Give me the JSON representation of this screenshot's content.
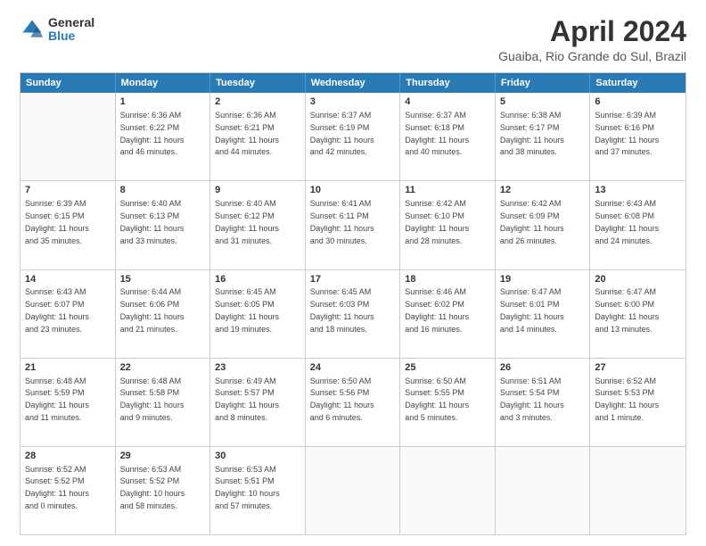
{
  "logo": {
    "general": "General",
    "blue": "Blue"
  },
  "title": "April 2024",
  "location": "Guaiba, Rio Grande do Sul, Brazil",
  "header_days": [
    "Sunday",
    "Monday",
    "Tuesday",
    "Wednesday",
    "Thursday",
    "Friday",
    "Saturday"
  ],
  "weeks": [
    [
      {
        "day": "",
        "text": ""
      },
      {
        "day": "1",
        "text": "Sunrise: 6:36 AM\nSunset: 6:22 PM\nDaylight: 11 hours\nand 46 minutes."
      },
      {
        "day": "2",
        "text": "Sunrise: 6:36 AM\nSunset: 6:21 PM\nDaylight: 11 hours\nand 44 minutes."
      },
      {
        "day": "3",
        "text": "Sunrise: 6:37 AM\nSunset: 6:19 PM\nDaylight: 11 hours\nand 42 minutes."
      },
      {
        "day": "4",
        "text": "Sunrise: 6:37 AM\nSunset: 6:18 PM\nDaylight: 11 hours\nand 40 minutes."
      },
      {
        "day": "5",
        "text": "Sunrise: 6:38 AM\nSunset: 6:17 PM\nDaylight: 11 hours\nand 38 minutes."
      },
      {
        "day": "6",
        "text": "Sunrise: 6:39 AM\nSunset: 6:16 PM\nDaylight: 11 hours\nand 37 minutes."
      }
    ],
    [
      {
        "day": "7",
        "text": "Sunrise: 6:39 AM\nSunset: 6:15 PM\nDaylight: 11 hours\nand 35 minutes."
      },
      {
        "day": "8",
        "text": "Sunrise: 6:40 AM\nSunset: 6:13 PM\nDaylight: 11 hours\nand 33 minutes."
      },
      {
        "day": "9",
        "text": "Sunrise: 6:40 AM\nSunset: 6:12 PM\nDaylight: 11 hours\nand 31 minutes."
      },
      {
        "day": "10",
        "text": "Sunrise: 6:41 AM\nSunset: 6:11 PM\nDaylight: 11 hours\nand 30 minutes."
      },
      {
        "day": "11",
        "text": "Sunrise: 6:42 AM\nSunset: 6:10 PM\nDaylight: 11 hours\nand 28 minutes."
      },
      {
        "day": "12",
        "text": "Sunrise: 6:42 AM\nSunset: 6:09 PM\nDaylight: 11 hours\nand 26 minutes."
      },
      {
        "day": "13",
        "text": "Sunrise: 6:43 AM\nSunset: 6:08 PM\nDaylight: 11 hours\nand 24 minutes."
      }
    ],
    [
      {
        "day": "14",
        "text": "Sunrise: 6:43 AM\nSunset: 6:07 PM\nDaylight: 11 hours\nand 23 minutes."
      },
      {
        "day": "15",
        "text": "Sunrise: 6:44 AM\nSunset: 6:06 PM\nDaylight: 11 hours\nand 21 minutes."
      },
      {
        "day": "16",
        "text": "Sunrise: 6:45 AM\nSunset: 6:05 PM\nDaylight: 11 hours\nand 19 minutes."
      },
      {
        "day": "17",
        "text": "Sunrise: 6:45 AM\nSunset: 6:03 PM\nDaylight: 11 hours\nand 18 minutes."
      },
      {
        "day": "18",
        "text": "Sunrise: 6:46 AM\nSunset: 6:02 PM\nDaylight: 11 hours\nand 16 minutes."
      },
      {
        "day": "19",
        "text": "Sunrise: 6:47 AM\nSunset: 6:01 PM\nDaylight: 11 hours\nand 14 minutes."
      },
      {
        "day": "20",
        "text": "Sunrise: 6:47 AM\nSunset: 6:00 PM\nDaylight: 11 hours\nand 13 minutes."
      }
    ],
    [
      {
        "day": "21",
        "text": "Sunrise: 6:48 AM\nSunset: 5:59 PM\nDaylight: 11 hours\nand 11 minutes."
      },
      {
        "day": "22",
        "text": "Sunrise: 6:48 AM\nSunset: 5:58 PM\nDaylight: 11 hours\nand 9 minutes."
      },
      {
        "day": "23",
        "text": "Sunrise: 6:49 AM\nSunset: 5:57 PM\nDaylight: 11 hours\nand 8 minutes."
      },
      {
        "day": "24",
        "text": "Sunrise: 6:50 AM\nSunset: 5:56 PM\nDaylight: 11 hours\nand 6 minutes."
      },
      {
        "day": "25",
        "text": "Sunrise: 6:50 AM\nSunset: 5:55 PM\nDaylight: 11 hours\nand 5 minutes."
      },
      {
        "day": "26",
        "text": "Sunrise: 6:51 AM\nSunset: 5:54 PM\nDaylight: 11 hours\nand 3 minutes."
      },
      {
        "day": "27",
        "text": "Sunrise: 6:52 AM\nSunset: 5:53 PM\nDaylight: 11 hours\nand 1 minute."
      }
    ],
    [
      {
        "day": "28",
        "text": "Sunrise: 6:52 AM\nSunset: 5:52 PM\nDaylight: 11 hours\nand 0 minutes."
      },
      {
        "day": "29",
        "text": "Sunrise: 6:53 AM\nSunset: 5:52 PM\nDaylight: 10 hours\nand 58 minutes."
      },
      {
        "day": "30",
        "text": "Sunrise: 6:53 AM\nSunset: 5:51 PM\nDaylight: 10 hours\nand 57 minutes."
      },
      {
        "day": "",
        "text": ""
      },
      {
        "day": "",
        "text": ""
      },
      {
        "day": "",
        "text": ""
      },
      {
        "day": "",
        "text": ""
      }
    ]
  ]
}
